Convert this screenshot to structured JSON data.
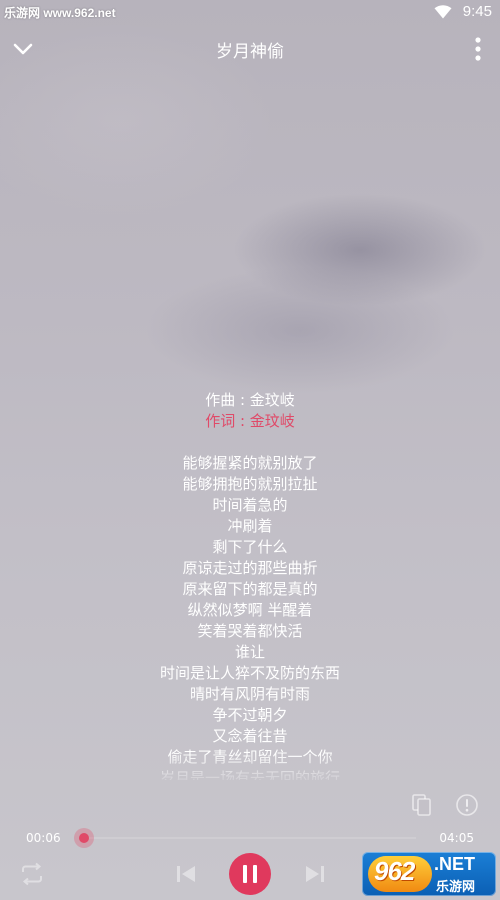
{
  "status_bar": {
    "watermark": "乐游网 www.962.net",
    "time": "9:45"
  },
  "header": {
    "title": "岁月神偷"
  },
  "lyrics": {
    "credits": [
      {
        "text": "作曲 : 金玟岐",
        "active": false
      },
      {
        "text": "作词 : 金玟岐",
        "active": true
      }
    ],
    "lines": [
      "能够握紧的就别放了",
      "能够拥抱的就别拉扯",
      "时间着急的",
      "冲刷着",
      "剩下了什么",
      "原谅走过的那些曲折",
      "原来留下的都是真的",
      "纵然似梦啊 半醒着",
      "笑着哭着都快活",
      "谁让",
      "时间是让人猝不及防的东西",
      "晴时有风阴有时雨",
      "争不过朝夕",
      "又念着往昔",
      "偷走了青丝却留住一个你",
      "岁月是一场有去无回的旅行"
    ]
  },
  "player": {
    "current_time": "00:06",
    "total_time": "04:05",
    "progress": 0.0,
    "accent_color": "#e0395d"
  },
  "site_logo": {
    "number": "962",
    "suffix": ".NET",
    "name": "乐游网"
  }
}
